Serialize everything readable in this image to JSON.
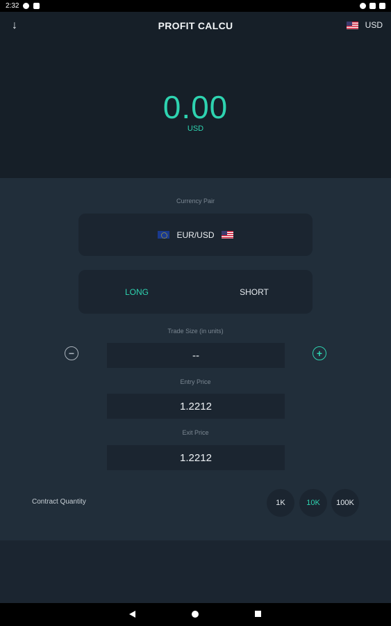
{
  "status": {
    "time": "2:32"
  },
  "header": {
    "title": "PROFIT CALCU",
    "currency": "USD"
  },
  "result": {
    "value": "0.00",
    "unit": "USD"
  },
  "form": {
    "currency_pair_label": "Currency Pair",
    "currency_pair": "EUR/USD",
    "long_label": "LONG",
    "short_label": "SHORT",
    "selected_direction": "LONG",
    "trade_size_label": "Trade Size (in units)",
    "trade_size_value": "--",
    "entry_price_label": "Entry Price",
    "entry_price_value": "1.2212",
    "exit_price_label": "Exit Price",
    "exit_price_value": "1.2212",
    "contract_quantity_label": "Contract Quantity",
    "quantity_options": [
      "1K",
      "10K",
      "100K"
    ],
    "selected_quantity": "10K"
  },
  "colors": {
    "accent": "#2ed3b0",
    "background": "#1b2530",
    "panel": "#212e3a",
    "header": "#161f28"
  },
  "icons": [
    "arrow-down-icon",
    "us-flag-icon",
    "eu-flag-icon",
    "minus-circle-icon",
    "plus-circle-icon",
    "nav-back-icon",
    "nav-home-icon",
    "nav-recents-icon"
  ]
}
